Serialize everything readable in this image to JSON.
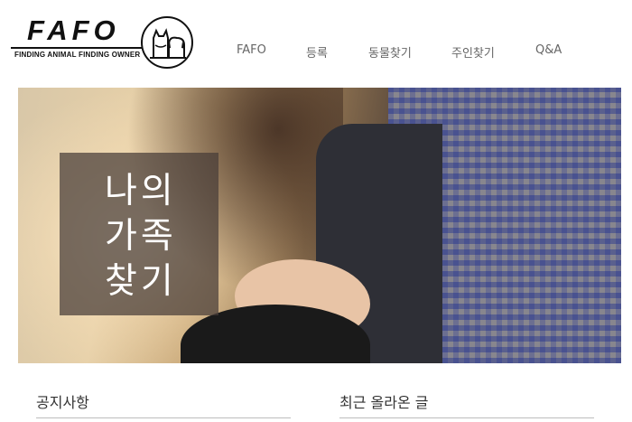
{
  "logo": {
    "title": "FAFO",
    "subtitle": "FINDING ANIMAL FINDING OWNER",
    "icon": "cat-dog-icon"
  },
  "nav": {
    "items": [
      {
        "label": "FAFO"
      },
      {
        "label": "등록"
      },
      {
        "label": "동물찾기"
      },
      {
        "label": "주인찾기"
      },
      {
        "label": "Q&A"
      }
    ]
  },
  "hero": {
    "caption_lines": [
      "나의",
      "가족",
      "찾기"
    ]
  },
  "sections": {
    "notice_title": "공지사항",
    "recent_title": "최근 올라온 글"
  }
}
